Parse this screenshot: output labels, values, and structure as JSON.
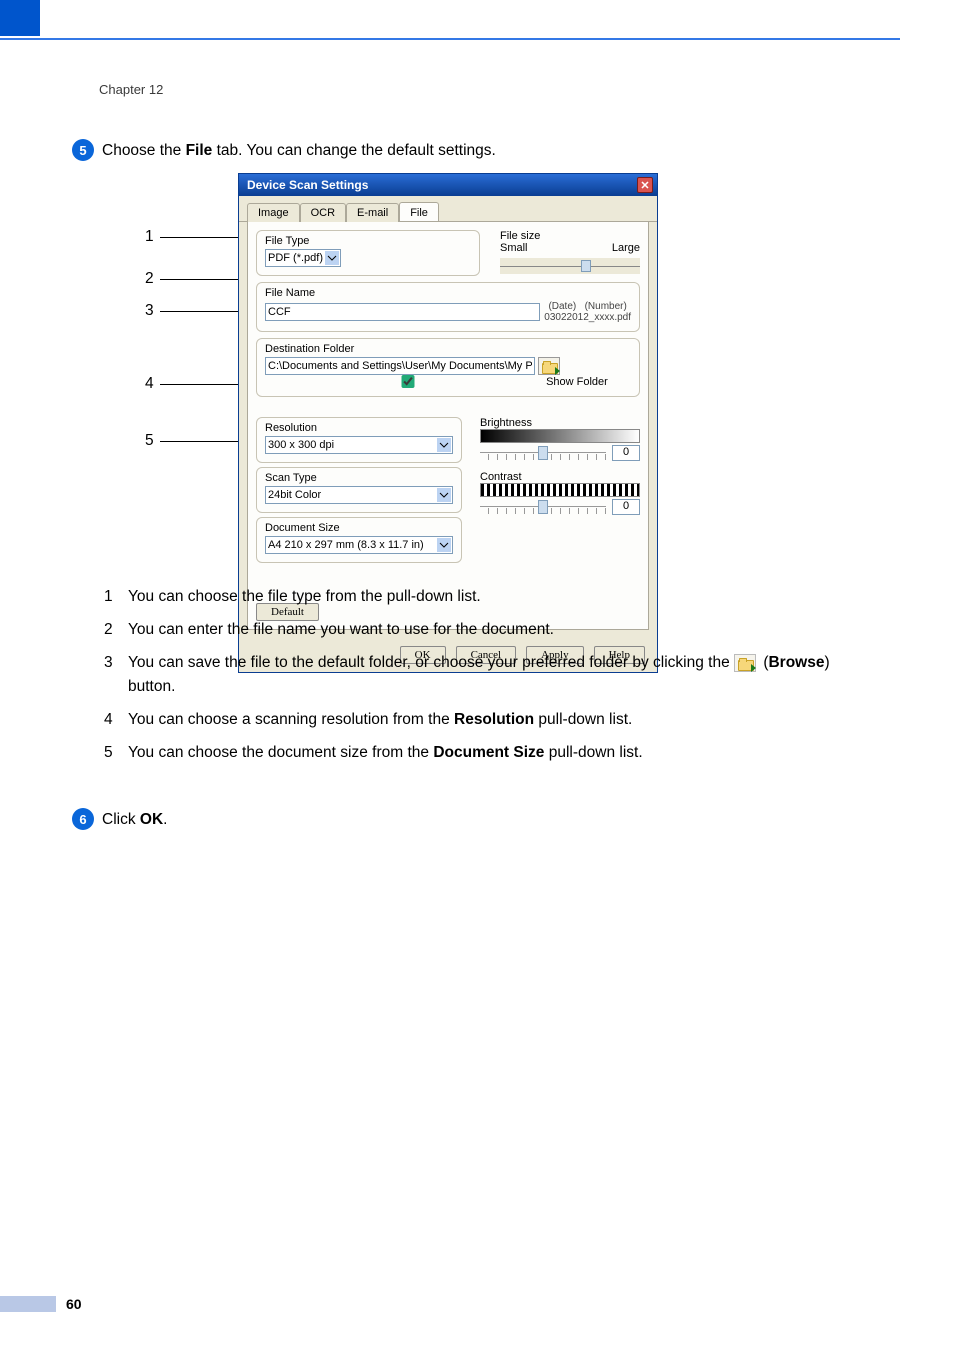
{
  "header": {
    "chapter": "Chapter 12"
  },
  "step5": {
    "num": "5",
    "text_before": "Choose the ",
    "bold": "File",
    "text_after": " tab. You can change the default settings."
  },
  "callout_labels": {
    "c1": "1",
    "c2": "2",
    "c3": "3",
    "c4": "4",
    "c5": "5"
  },
  "dialog": {
    "title": "Device Scan Settings",
    "tabs": {
      "image": "Image",
      "ocr": "OCR",
      "email": "E-mail",
      "file": "File"
    },
    "file_type": {
      "label": "File Type",
      "value": "PDF (*.pdf)"
    },
    "file_size": {
      "label": "File size",
      "small": "Small",
      "large": "Large"
    },
    "file_name": {
      "label": "File Name",
      "value": "CCF",
      "date_label": "(Date)",
      "number_label": "(Number)",
      "pattern": "03022012_xxxx.pdf"
    },
    "destination": {
      "label": "Destination Folder",
      "path": "C:\\Documents and Settings\\User\\My Documents\\My Pictures\\Cc",
      "show_folder": "Show Folder"
    },
    "resolution": {
      "label": "Resolution",
      "value": "300 x 300 dpi"
    },
    "scan_type": {
      "label": "Scan Type",
      "value": "24bit Color"
    },
    "doc_size": {
      "label": "Document Size",
      "value": "A4 210 x 297 mm (8.3 x 11.7 in)"
    },
    "brightness": {
      "label": "Brightness",
      "value": "0"
    },
    "contrast": {
      "label": "Contrast",
      "value": "0"
    },
    "default_btn": "Default",
    "buttons": {
      "ok": "OK",
      "cancel": "Cancel",
      "apply": "Apply",
      "help": "Help"
    }
  },
  "list": {
    "r1": {
      "n": "1",
      "t": "You can choose the file type from the pull-down list."
    },
    "r2": {
      "n": "2",
      "t": "You can enter the file name you want to use for the document."
    },
    "r3": {
      "n": "3",
      "t1": "You can save the file to the default folder, or choose your preferred folder by clicking the ",
      "bold": "Browse",
      "t2": ") button."
    },
    "r4": {
      "n": "4",
      "t1": "You can choose a scanning resolution from the ",
      "bold": "Resolution",
      "t2": " pull-down list."
    },
    "r5": {
      "n": "5",
      "t1": "You can choose the document size from the ",
      "bold": "Document Size",
      "t2": " pull-down list."
    }
  },
  "step6": {
    "num": "6",
    "before": "Click ",
    "bold": "OK",
    "after": "."
  },
  "page_number": "60"
}
